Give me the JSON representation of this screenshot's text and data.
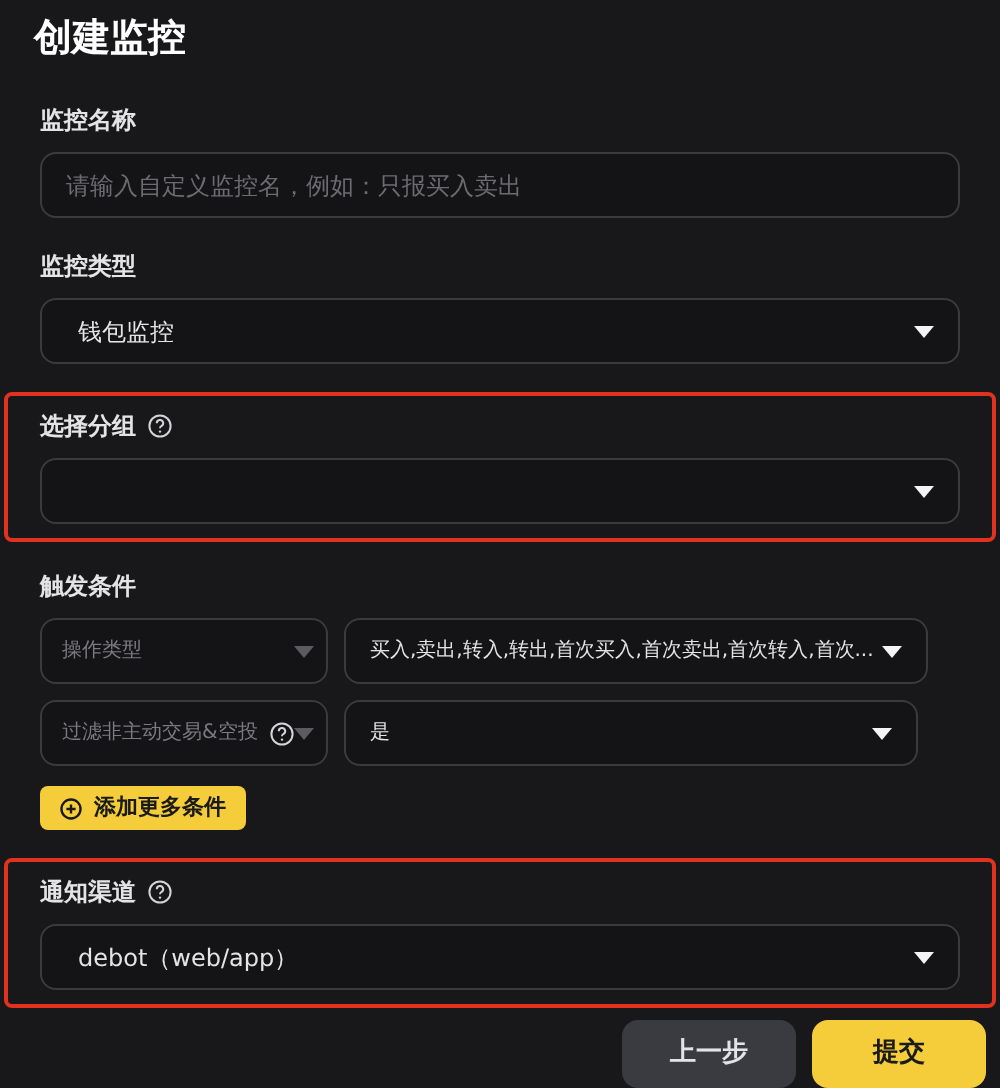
{
  "title": "创建监控",
  "sections": [
    {
      "kind": "input",
      "label": "监控名称",
      "help": false,
      "highlighted": false,
      "placeholder": "请输入自定义监控名，例如：只报买入卖出"
    },
    {
      "kind": "select",
      "label": "监控类型",
      "help": false,
      "highlighted": false,
      "value": "钱包监控"
    },
    {
      "kind": "select",
      "label": "选择分组",
      "help": true,
      "highlighted": true
    },
    {
      "kind": "conditions",
      "label": "触发条件",
      "help": false,
      "highlighted": false,
      "rows": [
        {
          "field": "操作类型",
          "field_help": false,
          "value": "买入,卖出,转入,转出,首次买入,首次卖出,首次转入,首次..."
        },
        {
          "field": "过滤非主动交易&空投",
          "field_help": true,
          "value": "是"
        }
      ],
      "add_button": "添加更多条件"
    },
    {
      "kind": "select",
      "label": "通知渠道",
      "help": true,
      "highlighted": true,
      "value": "debot（web/app）"
    }
  ],
  "buttons": [
    {
      "label": "上一步",
      "kind": "secondary"
    },
    {
      "label": "提交",
      "kind": "primary"
    }
  ]
}
